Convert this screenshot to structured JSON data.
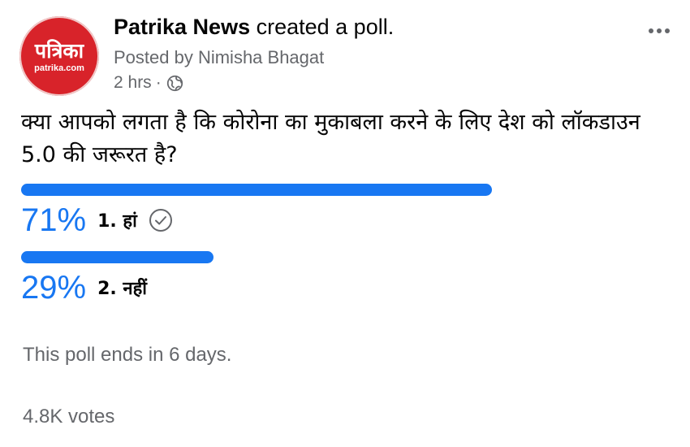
{
  "post": {
    "avatar": {
      "text": "पत्रिका",
      "site": "patrika.com",
      "color": "#d8232a"
    },
    "page_name": "Patrika News",
    "action_text": " created a poll.",
    "posted_by": "Posted by Nimisha Bhagat",
    "time": "2 hrs",
    "separator": "·",
    "privacy_icon": "globe-icon",
    "more_icon": "more-options-icon"
  },
  "poll": {
    "question": "क्या आपको लगता है कि कोरोना का मुकाबला करने के लिए देश को लॉकडाउन 5.0 की जरूरत है?",
    "accent_color": "#1877f2",
    "options": [
      {
        "percent_text": "71%",
        "percent": 71,
        "label": "1. हां",
        "selected": true
      },
      {
        "percent_text": "29%",
        "percent": 29,
        "label": "2. नहीं",
        "selected": false
      }
    ],
    "ends_text": "This poll ends in 6 days.",
    "votes_text": "4.8K votes"
  }
}
